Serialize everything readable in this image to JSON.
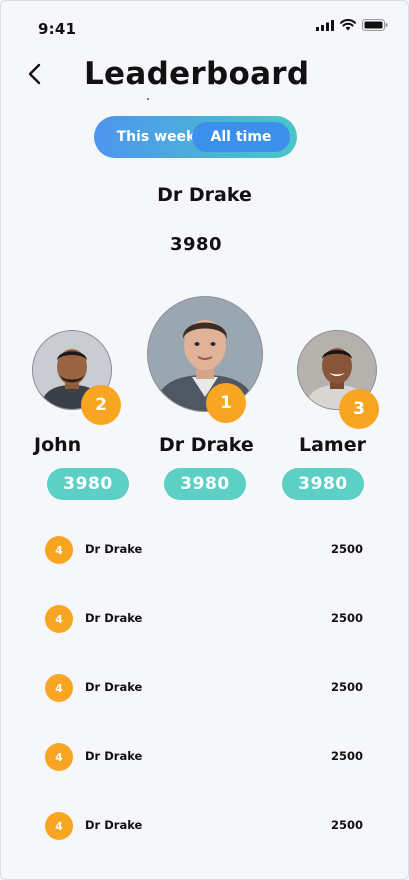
{
  "status_bar": {
    "time": "9:41"
  },
  "header": {
    "title": "Leaderboard"
  },
  "tabs": [
    {
      "label": "This week",
      "active": false
    },
    {
      "label": "All time",
      "active": true
    }
  ],
  "leader": {
    "name": "Dr Drake",
    "score": "3980"
  },
  "podium": [
    {
      "rank": "2",
      "name": "John",
      "score": "3980"
    },
    {
      "rank": "1",
      "name": "Dr Drake",
      "score": "3980"
    },
    {
      "rank": "3",
      "name": "Lamer",
      "score": "3980"
    }
  ],
  "list": [
    {
      "rank": "4",
      "name": "Dr Drake",
      "score": "2500"
    },
    {
      "rank": "4",
      "name": "Dr Drake",
      "score": "2500"
    },
    {
      "rank": "4",
      "name": "Dr Drake",
      "score": "2500"
    },
    {
      "rank": "4",
      "name": "Dr Drake",
      "score": "2500"
    },
    {
      "rank": "4",
      "name": "Dr Drake",
      "score": "2500"
    }
  ],
  "colors": {
    "accent_orange": "#f8a522",
    "score_pill": "#5cd0c4",
    "tab_gradient_start": "#4e95ef",
    "tab_gradient_end": "#49c7c6",
    "tab_active": "#3c8fea"
  },
  "icons": [
    "back-arrow-icon",
    "signal-icon",
    "wifi-icon",
    "battery-icon"
  ]
}
